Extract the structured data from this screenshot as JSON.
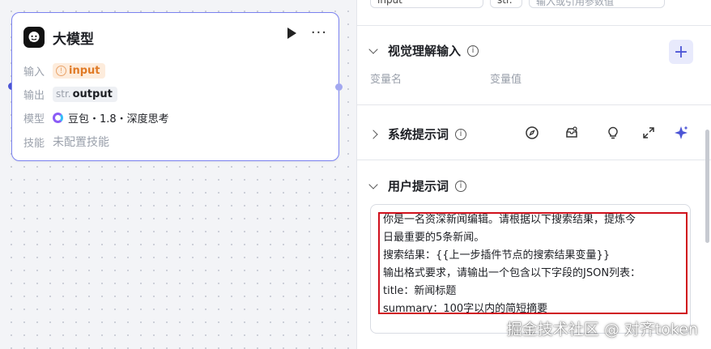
{
  "node": {
    "title": "大模型",
    "more": "···",
    "rows": {
      "input_label": "输入",
      "input_value": "input",
      "output_label": "输出",
      "output_type": "str.",
      "output_value": "output",
      "model_label": "模型",
      "model_value": "豆包・1.8・深度思考",
      "skill_label": "技能",
      "skill_value": "未配置技能"
    }
  },
  "panel": {
    "top_inputs": [
      "input",
      "str.",
      "输入或引用参数值"
    ],
    "visual": {
      "title": "视觉理解输入",
      "col_name": "变量名",
      "col_value": "变量值",
      "add": "+"
    },
    "system_prompt": {
      "title": "系统提示词"
    },
    "user_prompt": {
      "title": "用户提示词",
      "lines": [
        "你是一名资深新闻编辑。请根据以下搜索结果，提炼今",
        "日最重要的5条新闻。",
        "搜索结果：{{上一步插件节点的搜索结果变量}}",
        "输出格式要求，请输出一个包含以下字段的JSON列表：",
        "title：新闻标题",
        "summary：100字以内的简短摘要"
      ]
    }
  },
  "watermark": "掘金技术社区 @ 对齐token",
  "colors": {
    "accent": "#4c55d6",
    "node_border": "#7b82f0",
    "warn": "#e07a26",
    "highlight_box": "#d0101c"
  }
}
